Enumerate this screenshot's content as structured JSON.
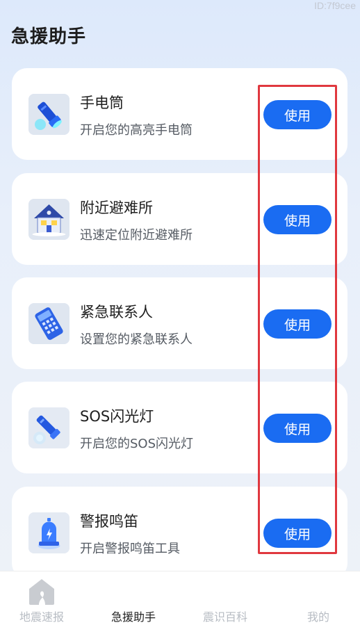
{
  "watermark": "ID:7f9cee",
  "header": {
    "title": "急援助手"
  },
  "tools": [
    {
      "title": "手电筒",
      "desc": "开启您的高亮手电筒",
      "button": "使用",
      "icon": "flashlight-icon"
    },
    {
      "title": "附近避难所",
      "desc": "迅速定位附近避难所",
      "button": "使用",
      "icon": "shelter-house-icon"
    },
    {
      "title": "紧急联系人",
      "desc": "设置您的紧急联系人",
      "button": "使用",
      "icon": "phone-keypad-icon"
    },
    {
      "title": "SOS闪光灯",
      "desc": "开启您的SOS闪光灯",
      "button": "使用",
      "icon": "sos-flashlight-icon"
    },
    {
      "title": "警报鸣笛",
      "desc": "开启警报鸣笛工具",
      "button": "使用",
      "icon": "siren-icon"
    }
  ],
  "tabbar": {
    "items": [
      {
        "label": "地震速报",
        "icon": "home-icon"
      },
      {
        "label": "急援助手"
      },
      {
        "label": "震识百科"
      },
      {
        "label": "我的"
      }
    ],
    "active_index": 1
  },
  "colors": {
    "accent": "#1a6cf2",
    "highlight": "#e0383f",
    "background_top": "#dde9fb",
    "card": "#ffffff"
  }
}
